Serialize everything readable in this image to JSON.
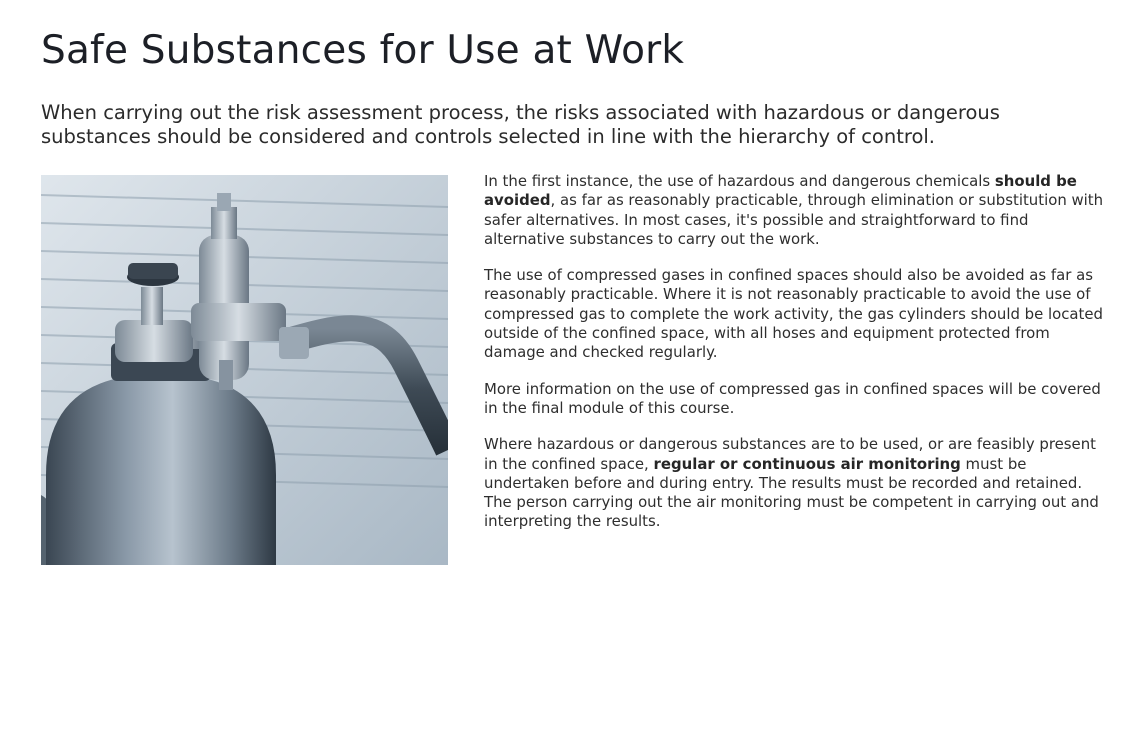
{
  "page": {
    "title": "Safe Substances for Use at Work",
    "intro": "When carrying out the risk assessment process, the risks associated with hazardous or dangerous substances should be considered and controls selected in line with the hierarchy of control."
  },
  "image": {
    "icon": "gas-cylinder-photo"
  },
  "paragraphs": [
    {
      "pre": "In the first instance, the use of hazardous and dangerous chemicals ",
      "bold": "should be avoided",
      "post": ", as far as reasonably practicable, through elimination or substitution with safer alternatives. In most cases, it's possible and straightforward to find alternative substances to carry out the work."
    },
    {
      "text": "The use of compressed gases in confined spaces should also be avoided as far as reasonably practicable. Where it is not reasonably practicable to avoid the use of compressed gas to complete the work activity, the gas cylinders should be located outside of the confined space, with all hoses and equipment protected from damage and checked regularly."
    },
    {
      "text": "More information on the use of compressed gas in confined spaces will be covered in the final module of this course."
    },
    {
      "pre": "Where hazardous or dangerous substances are to be used, or are feasibly present in the confined space, ",
      "bold": "regular or continuous air monitoring",
      "post": " must be undertaken before and during entry. The results must be recorded and retained. The person carrying out the air monitoring must be competent in carrying out and interpreting the results."
    }
  ],
  "colors": {
    "title": "#1c1f26",
    "text": "#2e2e2e",
    "background": "#ffffff"
  }
}
